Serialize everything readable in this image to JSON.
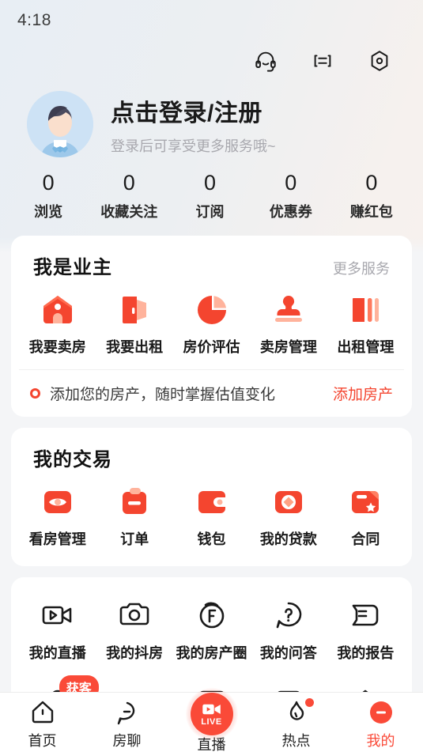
{
  "status": {
    "time": "4:18"
  },
  "top_icons": [
    {
      "name": "headset-icon",
      "label": "客服"
    },
    {
      "name": "list-icon",
      "label": "列表"
    },
    {
      "name": "settings-icon",
      "label": "设置"
    }
  ],
  "profile": {
    "title": "点击登录/注册",
    "subtitle": "登录后可享受更多服务哦~",
    "avatar_alt": "默认头像"
  },
  "stats": [
    {
      "value": "0",
      "label": "浏览"
    },
    {
      "value": "0",
      "label": "收藏关注"
    },
    {
      "value": "0",
      "label": "订阅"
    },
    {
      "value": "0",
      "label": "优惠券"
    },
    {
      "value": "0",
      "label": "赚红包"
    }
  ],
  "owner_card": {
    "title": "我是业主",
    "more": "更多服务",
    "items": [
      {
        "label": "我要卖房",
        "icon": "house-tag-icon"
      },
      {
        "label": "我要出租",
        "icon": "open-door-icon"
      },
      {
        "label": "房价评估",
        "icon": "pie-chart-icon"
      },
      {
        "label": "卖房管理",
        "icon": "stamp-icon"
      },
      {
        "label": "出租管理",
        "icon": "book-pages-icon"
      }
    ],
    "promo_text": "添加您的房产，随时掌握估值变化",
    "promo_button": "添加房产"
  },
  "trade_card": {
    "title": "我的交易",
    "items": [
      {
        "label": "看房管理",
        "icon": "eye-square-icon"
      },
      {
        "label": "订单",
        "icon": "clipboard-icon"
      },
      {
        "label": "钱包",
        "icon": "wallet-icon"
      },
      {
        "label": "我的贷款",
        "icon": "coin-icon"
      },
      {
        "label": "合同",
        "icon": "contract-star-icon"
      }
    ]
  },
  "content_card": {
    "items": [
      {
        "label": "我的直播",
        "icon": "video-camera-icon",
        "badge": ""
      },
      {
        "label": "我的抖房",
        "icon": "camera-icon",
        "badge": ""
      },
      {
        "label": "我的房产圈",
        "icon": "f-circle-icon",
        "badge": ""
      },
      {
        "label": "我的问答",
        "icon": "question-bubble-icon",
        "badge": ""
      },
      {
        "label": "我的报告",
        "icon": "report-folder-icon",
        "badge": ""
      }
    ],
    "row2": [
      {
        "label": "",
        "icon": "person-outline-icon",
        "badge": "获客"
      },
      {
        "label": "",
        "icon": "chart-face-icon",
        "badge": ""
      },
      {
        "label": "",
        "icon": "card-outline-icon",
        "badge": ""
      },
      {
        "label": "",
        "icon": "close-box-icon",
        "badge": ""
      },
      {
        "label": "",
        "icon": "home-outline-icon",
        "badge": ""
      }
    ]
  },
  "tabbar": [
    {
      "label": "首页",
      "icon": "home-icon",
      "active": false,
      "dot": false
    },
    {
      "label": "房聊",
      "icon": "chat-bubble-icon",
      "active": false,
      "dot": false
    },
    {
      "label": "直播",
      "icon": "live-icon",
      "active": false,
      "dot": false,
      "live_text": "LIVE"
    },
    {
      "label": "热点",
      "icon": "fire-icon",
      "active": false,
      "dot": true
    },
    {
      "label": "我的",
      "icon": "profile-icon",
      "active": true,
      "dot": false
    }
  ],
  "colors": {
    "accent": "#fa4a38",
    "accent_deep": "#f4452f",
    "text": "#1a1a1a",
    "muted": "#a8a8ae",
    "card_bg": "#ffffff",
    "page_bg": "#f4f5f7"
  }
}
